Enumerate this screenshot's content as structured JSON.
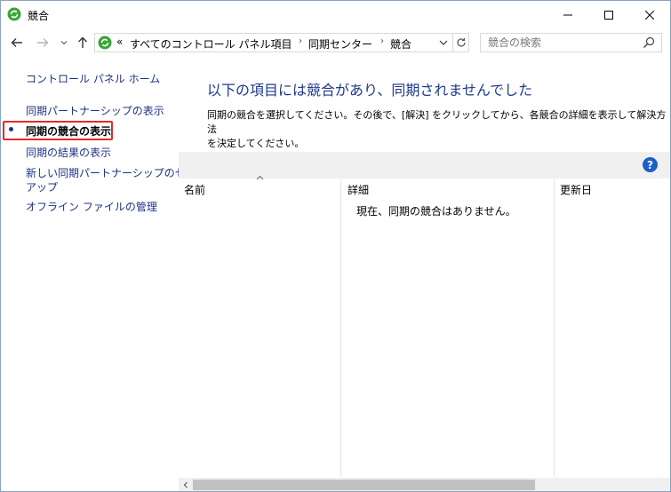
{
  "window": {
    "title": "競合",
    "icon": "sync-center-icon"
  },
  "nav": {
    "breadcrumb_overflow": "«",
    "breadcrumbs": [
      "すべてのコントロール パネル項目",
      "同期センター",
      "競合"
    ],
    "search_placeholder": "競合の検索"
  },
  "sidebar": {
    "home": "コントロール パネル ホーム",
    "items": [
      {
        "label": "同期パートナーシップの表示",
        "active": false
      },
      {
        "label": "同期の競合の表示",
        "active": true
      },
      {
        "label": "同期の結果の表示",
        "active": false
      },
      {
        "label": "新しい同期パートナーシップのセットアップ",
        "line1": "新しい同期パートナーシップのセット",
        "line2": "アップ",
        "active": false
      },
      {
        "label": "オフライン ファイルの管理",
        "active": false
      }
    ]
  },
  "main": {
    "heading": "以下の項目には競合があり、同期されませんでした",
    "description_line1": "同期の競合を選択してください。その後で、[解決] をクリックしてから、各競合の詳細を表示して解決方法",
    "description_line2": "を決定してください。",
    "columns": [
      "名前",
      "詳細",
      "更新日"
    ],
    "empty_message": "現在、同期の競合はありません。"
  },
  "colors": {
    "link": "#1e3287",
    "heading": "#1e3a8a",
    "highlight": "#e32b2b",
    "help": "#1d5ec9"
  }
}
